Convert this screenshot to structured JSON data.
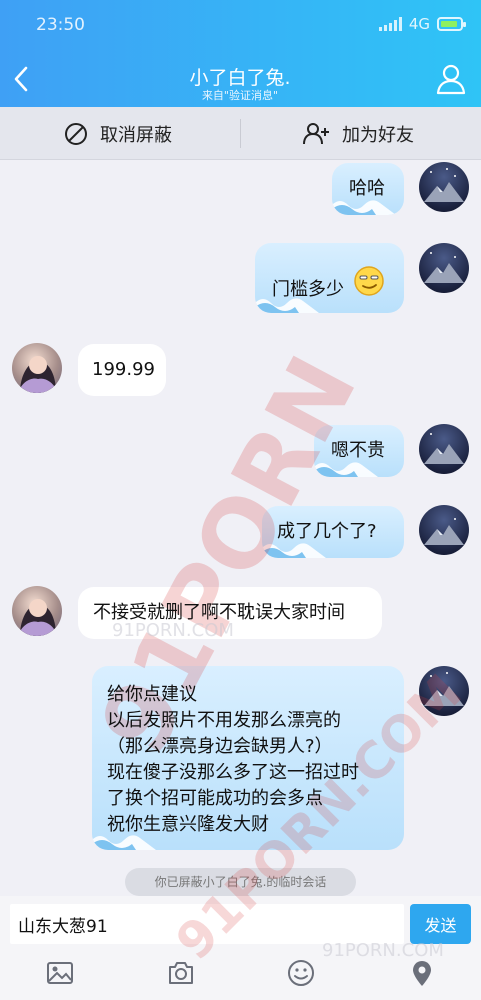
{
  "status_bar": {
    "time": "23:50",
    "network": "4G"
  },
  "header": {
    "title": "小了白了兔.",
    "subtitle": "来自\"验证消息\""
  },
  "actions": {
    "unblock_label": "取消屏蔽",
    "add_friend_label": "加为好友"
  },
  "messages": [
    {
      "sender": "me",
      "text": "哈哈"
    },
    {
      "sender": "me",
      "text": "门槛多少",
      "emoji": "smirk-face"
    },
    {
      "sender": "other",
      "text": "199.99"
    },
    {
      "sender": "me",
      "text": "嗯不贵"
    },
    {
      "sender": "me",
      "text": "成了几个了?"
    },
    {
      "sender": "other",
      "text": "不接受就删了啊不耽误大家时间"
    },
    {
      "sender": "me",
      "lines": [
        "给你点建议",
        "以后发照片不用发那么漂亮的",
        "（那么漂亮身边会缺男人?）",
        "现在傻子没那么多了这一招过时",
        "了换个招可能成功的会多点",
        "祝你生意兴隆发大财"
      ]
    }
  ],
  "notice": "你已屏蔽小了白了兔.的临时会话",
  "composer": {
    "input_value": "山东大葱91",
    "send_label": "发送"
  },
  "watermark": {
    "large": "91PORN",
    "small": "91PORN.COM"
  },
  "colors": {
    "header_start": "#3fa0f5",
    "header_end": "#2fc4f6",
    "my_bubble": "#c6e6fc",
    "send_button": "#2ea7ef"
  }
}
